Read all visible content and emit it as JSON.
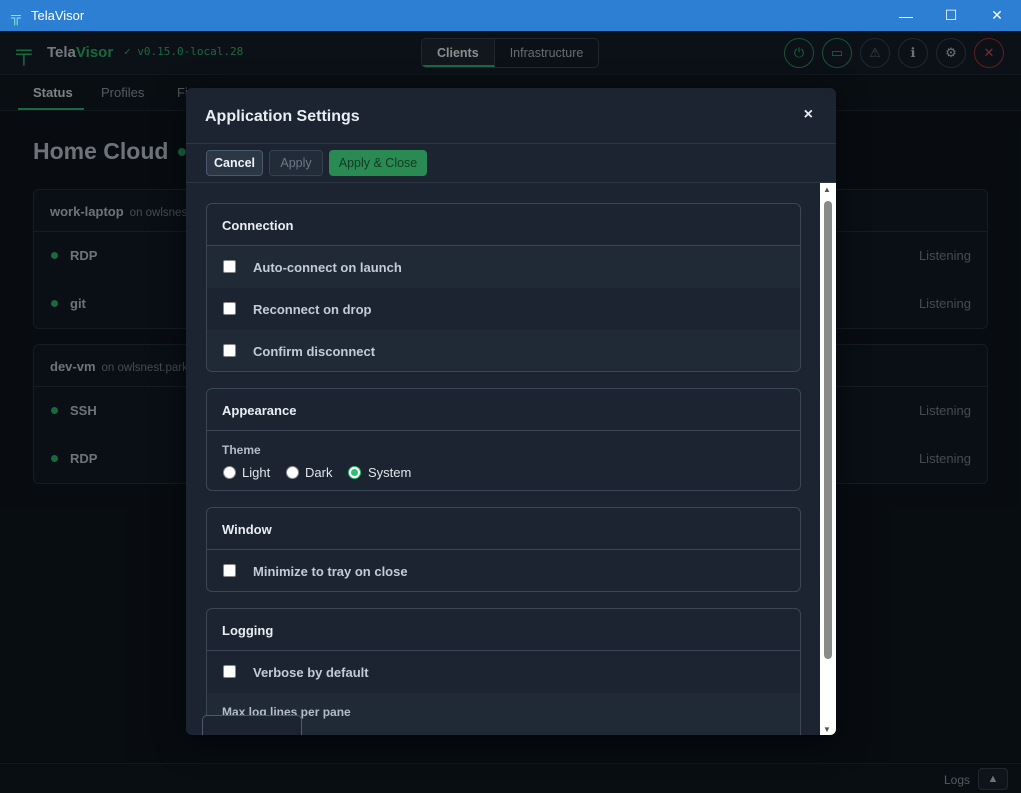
{
  "window": {
    "title": "TelaVisor"
  },
  "header": {
    "brand_part1": "Tela",
    "brand_part2": "Visor",
    "version": "✓ v0.15.0-local.28",
    "segments": [
      "Clients",
      "Infrastructure"
    ],
    "active_segment": "Clients",
    "icons": [
      "power-icon",
      "folder-icon",
      "warning-icon",
      "info-icon",
      "gear-icon",
      "close-icon"
    ]
  },
  "tabs": [
    "Status",
    "Profiles",
    "Fi"
  ],
  "active_tab": "Status",
  "background": {
    "title": "Home Cloud",
    "cards": [
      {
        "name": "work-laptop",
        "host": "on owlsnest",
        "services": [
          {
            "name": "RDP",
            "status": "Listening"
          },
          {
            "name": "git",
            "status": "Listening"
          }
        ]
      },
      {
        "name": "dev-vm",
        "host": "on owlsnest.parks",
        "services": [
          {
            "name": "SSH",
            "status": "Listening"
          },
          {
            "name": "RDP",
            "status": "Listening"
          }
        ]
      }
    ]
  },
  "statusbar": {
    "logs_label": "Logs"
  },
  "dialog": {
    "title": "Application Settings",
    "close": "×",
    "buttons": {
      "cancel": "Cancel",
      "apply": "Apply",
      "apply_close": "Apply & Close"
    },
    "sections": {
      "connection": {
        "title": "Connection",
        "options": [
          {
            "label": "Auto-connect on launch",
            "checked": false
          },
          {
            "label": "Reconnect on drop",
            "checked": false
          },
          {
            "label": "Confirm disconnect",
            "checked": false
          }
        ]
      },
      "appearance": {
        "title": "Appearance",
        "theme_label": "Theme",
        "theme_options": [
          "Light",
          "Dark",
          "System"
        ],
        "theme_selected": "System"
      },
      "window": {
        "title": "Window",
        "options": [
          {
            "label": "Minimize to tray on close",
            "checked": false
          }
        ]
      },
      "logging": {
        "title": "Logging",
        "options": [
          {
            "label": "Verbose by default",
            "checked": false
          }
        ],
        "max_lines_label": "Max log lines per pane"
      }
    }
  },
  "colors": {
    "accent": "#2fbf71",
    "titlebar": "#2d7fd3",
    "danger": "#e05050"
  }
}
